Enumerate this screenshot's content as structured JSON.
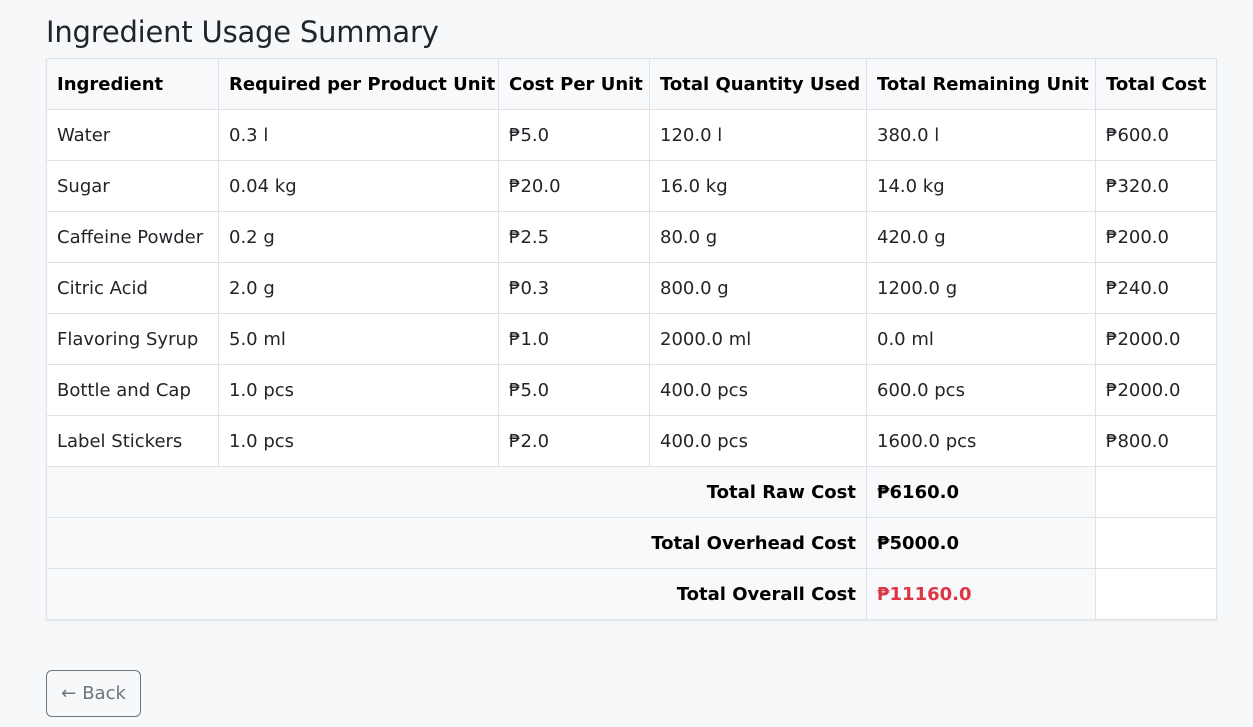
{
  "page": {
    "title": "Ingredient Usage Summary"
  },
  "table": {
    "headers": [
      "Ingredient",
      "Required per Product Unit",
      "Cost Per Unit",
      "Total Quantity Used",
      "Total Remaining Unit",
      "Total Cost"
    ],
    "rows": [
      [
        "Water",
        "0.3 l",
        "₱5.0",
        "120.0 l",
        "380.0 l",
        "₱600.0"
      ],
      [
        "Sugar",
        "0.04 kg",
        "₱20.0",
        "16.0 kg",
        "14.0 kg",
        "₱320.0"
      ],
      [
        "Caffeine Powder",
        "0.2 g",
        "₱2.5",
        "80.0 g",
        "420.0 g",
        "₱200.0"
      ],
      [
        "Citric Acid",
        "2.0 g",
        "₱0.3",
        "800.0 g",
        "1200.0 g",
        "₱240.0"
      ],
      [
        "Flavoring Syrup",
        "5.0 ml",
        "₱1.0",
        "2000.0 ml",
        "0.0 ml",
        "₱2000.0"
      ],
      [
        "Bottle and Cap",
        "1.0 pcs",
        "₱5.0",
        "400.0 pcs",
        "600.0 pcs",
        "₱2000.0"
      ],
      [
        "Label Stickers",
        "1.0 pcs",
        "₱2.0",
        "400.0 pcs",
        "1600.0 pcs",
        "₱800.0"
      ]
    ]
  },
  "totals": {
    "raw_label": "Total Raw Cost",
    "raw_value": "₱6160.0",
    "overhead_label": "Total Overhead Cost",
    "overhead_value": "₱5000.0",
    "overall_label": "Total Overall Cost",
    "overall_value": "₱11160.0",
    "overall_color": "#dc3545"
  },
  "back_button": {
    "arrow": "←",
    "label": "Back"
  }
}
